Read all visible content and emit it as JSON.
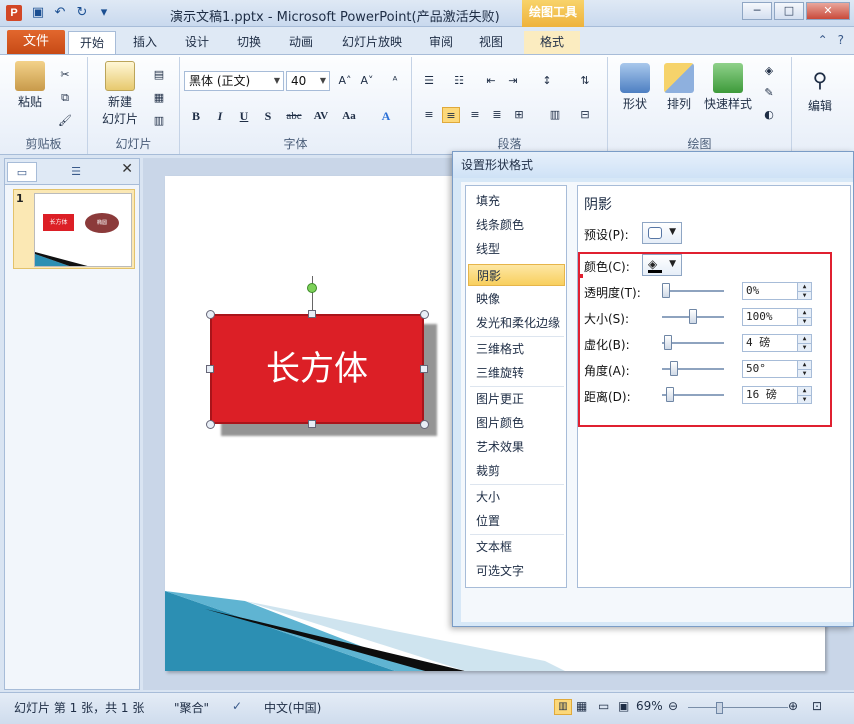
{
  "app": {
    "title": "演示文稿1.pptx - Microsoft PowerPoint(产品激活失败)",
    "context_tab_group": "绘图工具",
    "icon_letter": "P",
    "controls": [
      "─",
      "□",
      "✕"
    ]
  },
  "tabs": {
    "file": "文件",
    "items": [
      "开始",
      "插入",
      "设计",
      "切换",
      "动画",
      "幻灯片放映",
      "审阅",
      "视图",
      "格式"
    ],
    "active": "开始"
  },
  "ribbon": {
    "clipboard": {
      "paste": "粘贴",
      "label": "剪贴板"
    },
    "slides": {
      "new_slide": "新建\n幻灯片",
      "new_slide_l1": "新建",
      "new_slide_l2": "幻灯片",
      "label": "幻灯片"
    },
    "font": {
      "family": "黑体 (正文)",
      "size": "40",
      "label": "字体",
      "buttons": [
        "B",
        "I",
        "U",
        "S",
        "abc",
        "AV",
        "Aa",
        "A"
      ]
    },
    "paragraph": {
      "label": "段落"
    },
    "drawing": {
      "shapes": "形状",
      "arrange": "排列",
      "quick_styles": "快速样式",
      "label": "绘图"
    },
    "editing": {
      "edit": "编辑"
    }
  },
  "left_pane": {
    "slide_number": "1",
    "thumb_text": "长方体",
    "thumb_ellipse_text": "椭圆"
  },
  "slide": {
    "shape_text": "长方体"
  },
  "status": {
    "slide_info": "幻灯片 第 1 张，共 1 张",
    "theme": "\"聚合\"",
    "language": "中文(中国)",
    "zoom": "69%"
  },
  "dialog": {
    "title": "设置形状格式",
    "categories": [
      "填充",
      "线条颜色",
      "线型",
      "阴影",
      "映像",
      "发光和柔化边缘",
      "三维格式",
      "三维旋转",
      "图片更正",
      "图片颜色",
      "艺术效果",
      "裁剪",
      "大小",
      "位置",
      "文本框",
      "可选文字"
    ],
    "active_category": "阴影",
    "panel_title": "阴影",
    "preset_label": "预设(P):",
    "color_label": "颜色(C):",
    "rows": [
      {
        "label": "透明度(T):",
        "value": "0%",
        "level": 0.0
      },
      {
        "label": "大小(S):",
        "value": "100%",
        "level": 0.5
      },
      {
        "label": "虚化(B):",
        "value": "4 磅",
        "level": 0.04
      },
      {
        "label": "角度(A):",
        "value": "50°",
        "level": 0.14
      },
      {
        "label": "距离(D):",
        "value": "16 磅",
        "level": 0.08
      }
    ]
  },
  "colors": {
    "shape_fill": "#dc1f26",
    "accent_orange": "#c74a16",
    "highlight_red": "#e02030"
  }
}
